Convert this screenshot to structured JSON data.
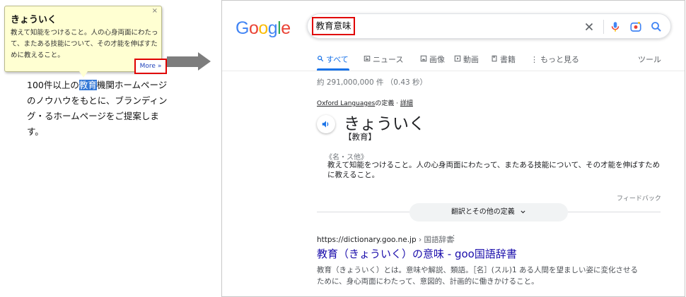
{
  "popup": {
    "close": "×",
    "word": "きょういく",
    "definition": "教えて知能をつけること。人の心身両面にわたって、またある技能について、その才能を伸ばすために教えること。",
    "more_label": "More »"
  },
  "page_text": {
    "before": "100件以上の",
    "highlight": "教育",
    "after": "機関ホームページのノウハウをもとに、ブランディング・るホームページをご提案します。"
  },
  "google": {
    "logo": [
      "G",
      "o",
      "o",
      "g",
      "l",
      "e"
    ],
    "logo_colors": [
      "#4285f4",
      "#ea4335",
      "#fbbc05",
      "#4285f4",
      "#34a853",
      "#ea4335"
    ],
    "query": "教育意味",
    "tabs": [
      {
        "label": "すべて",
        "icon": "search-icon"
      },
      {
        "label": "ニュース",
        "icon": "news-icon"
      },
      {
        "label": "画像",
        "icon": "image-icon"
      },
      {
        "label": "動画",
        "icon": "video-icon"
      },
      {
        "label": "書籍",
        "icon": "book-icon"
      },
      {
        "label": "もっと見る",
        "icon": "more-vert-icon"
      }
    ],
    "tools_label": "ツール",
    "stats": "約 291,000,000 件 （0.43 秒）",
    "oxford_source": "Oxford Languages",
    "oxford_suffix": "の定義 · ",
    "oxford_details": "詳細",
    "headword": "きょういく",
    "kanji": "【教育】",
    "pos": "《名・ス他》",
    "meaning": "教えて知能をつけること。人の心身両面にわたって、またある技能について、その才能を伸ばすために教えること。",
    "feedback": "フィードバック",
    "more_definitions": "翻訳とその他の定義",
    "result": {
      "url": "https://dictionary.goo.ne.jp",
      "breadcrumb": " › 国語辞書",
      "dots": "⋮",
      "title": "教育（きょういく）の意味 - goo国語辞書",
      "snippet": "教育（きょういく）とは。意味や解説、類語。［名］(スル)1 ある人間を望ましい姿に変化させるために、身心両面にわたって、意図的、計画的に働きかけること。"
    }
  }
}
